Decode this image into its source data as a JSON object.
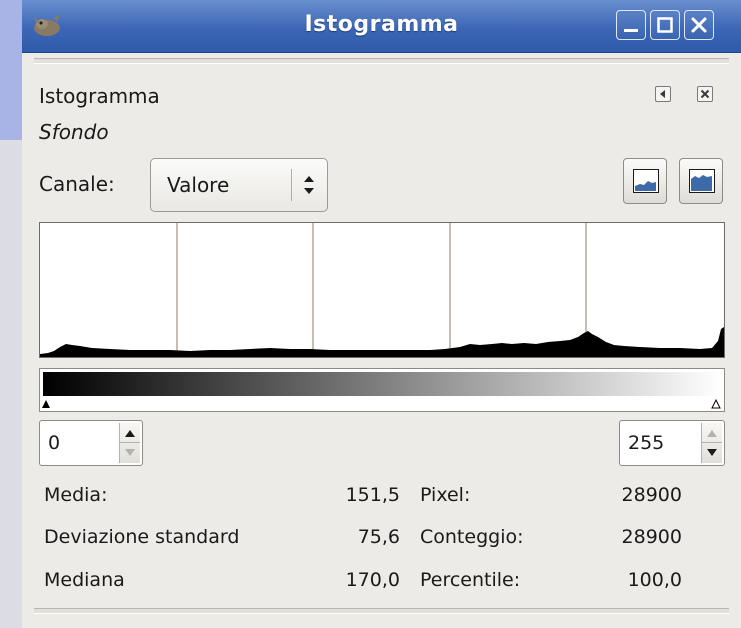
{
  "window": {
    "title": "Istogramma"
  },
  "dock": {
    "title": "Istogramma",
    "subtitle": "Sfondo"
  },
  "channel": {
    "label": "Canale:",
    "selected": "Valore"
  },
  "range": {
    "min_value": "0",
    "max_value": "255"
  },
  "stats": {
    "mean_label": "Media:",
    "mean_value": "151,5",
    "stddev_label": "Deviazione standard",
    "stddev_value": "75,6",
    "median_label": "Mediana",
    "median_value": "170,0",
    "pixels_label": "Pixel:",
    "pixels_value": "28900",
    "count_label": "Conteggio:",
    "count_value": "28900",
    "percentile_label": "Percentile:",
    "percentile_value": "100,0"
  },
  "icons": {
    "app": "gimp-wilber-icon",
    "minimize": "minimize-icon",
    "maximize": "maximize-icon",
    "close": "close-icon",
    "tab_menu": "tab-menu-icon",
    "close_tab": "close-tab-icon",
    "linear": "linear-histogram-icon",
    "log": "logarithmic-histogram-icon"
  },
  "colors": {
    "titlebar": "#3c66b6",
    "window_bg": "#ecebe7",
    "histogram_bg": "#ffffff",
    "histogram_fill": "#000000"
  }
}
